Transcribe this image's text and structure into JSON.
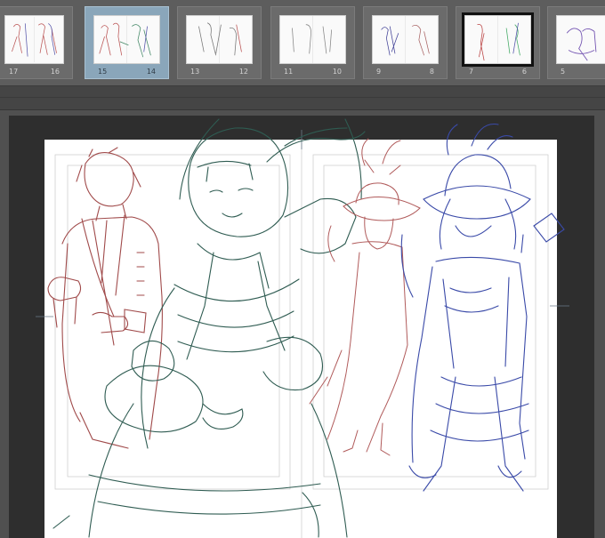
{
  "app": {
    "view": "page-manager-with-canvas"
  },
  "spreads": [
    {
      "left_page": "17",
      "right_page": "16",
      "state": "normal"
    },
    {
      "left_page": "15",
      "right_page": "14",
      "state": "selected"
    },
    {
      "left_page": "13",
      "right_page": "12",
      "state": "normal"
    },
    {
      "left_page": "11",
      "right_page": "10",
      "state": "normal"
    },
    {
      "left_page": "9",
      "right_page": "8",
      "state": "normal"
    },
    {
      "left_page": "7",
      "right_page": "6",
      "state": "current"
    },
    {
      "left_page": "5",
      "right_page": "",
      "state": "normal"
    }
  ],
  "colors": {
    "strip_bg": "#5d5d5d",
    "selected_spread": "#8aa6ba",
    "pasteboard": "#2e2e2e",
    "sketch_red": "#a04a4a",
    "sketch_green": "#2f5c52",
    "sketch_blue": "#3a4aa8"
  },
  "icons": [
    "crop-mark-icon"
  ]
}
